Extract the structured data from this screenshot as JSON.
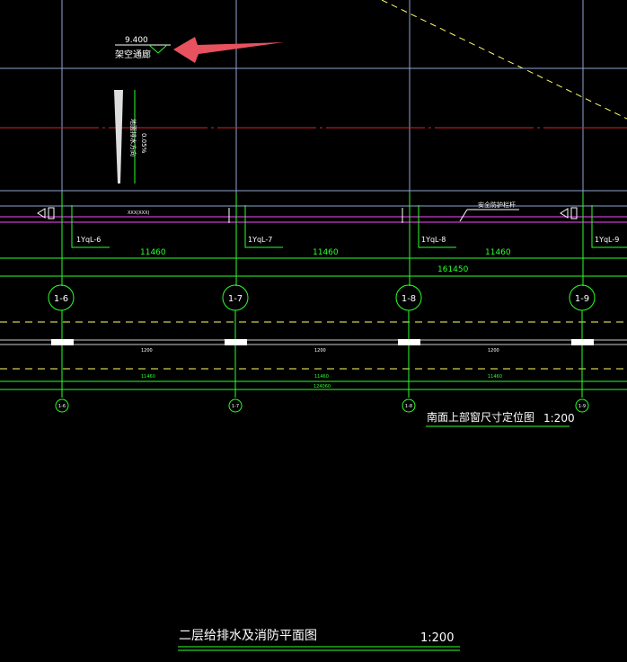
{
  "colors": {
    "background": "#000000",
    "grid_line": "#8fa3d0",
    "green": "#2bff2b",
    "red": "#e02020",
    "yellow": "#ffff66",
    "magenta": "#ff44ff",
    "white": "#ffffff",
    "annotation_arrow": "#e8515e"
  },
  "top_annotation": {
    "elevation": "9.400",
    "label": "架空通廊"
  },
  "vertical_note": {
    "text": "地面排水方向",
    "slope": "0.05%"
  },
  "safety_label": "安全防护栏杆",
  "pipe_label": "XXX(XXX)",
  "risers": [
    "1YqL-6",
    "1YqL-7",
    "1YqL-8",
    "1YqL-9"
  ],
  "upper_dims": [
    "11460",
    "11460",
    "11460"
  ],
  "upper_total": "161450",
  "grid_axes": [
    "1-6",
    "1-7",
    "1-8",
    "1-9"
  ],
  "lower_section": {
    "centers": [
      "1200",
      "1200",
      "1200"
    ],
    "spans": [
      "11460",
      "11460",
      "11460"
    ],
    "total": "124060"
  },
  "small_axes": [
    "1-6",
    "1-7",
    "1-8",
    "1-9"
  ],
  "window_plan": {
    "title": "南面上部窗尺寸定位图",
    "scale": "1:200"
  },
  "main_title": {
    "title": "二层给排水及消防平面图",
    "scale": "1:200"
  }
}
